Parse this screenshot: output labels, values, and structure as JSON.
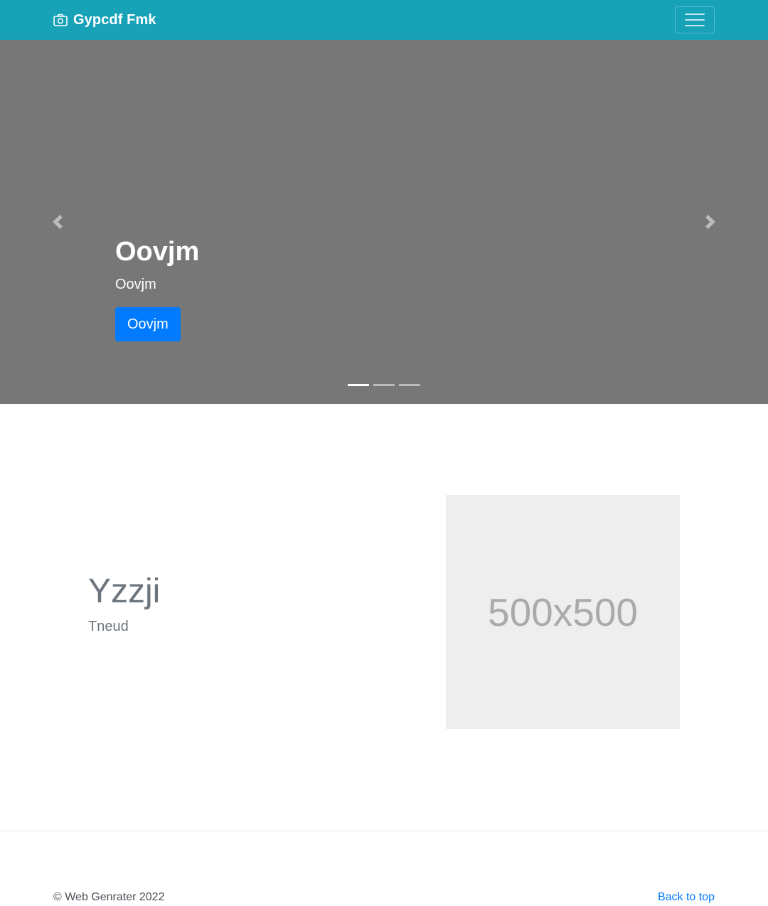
{
  "theme": {
    "nav_bg": "#17a2b8",
    "carousel_bg": "#777777",
    "primary": "#007bff"
  },
  "navbar": {
    "brand_icon": "camera-icon",
    "brand_text": "Gypcdf Fmk",
    "toggler_icon": "hamburger-menu-icon"
  },
  "carousel": {
    "prev_icon": "chevron-left-icon",
    "next_icon": "chevron-right-icon",
    "active_index": 0,
    "slides_count": 3,
    "caption": {
      "title": "Oovjm",
      "text": "Oovjm",
      "button_label": "Oovjm"
    }
  },
  "feature": {
    "heading": "Yzzji",
    "lead": "Tneud",
    "image_placeholder": "500x500"
  },
  "footer": {
    "copyright": "© Web Genrater 2022",
    "back_to_top": "Back to top"
  }
}
